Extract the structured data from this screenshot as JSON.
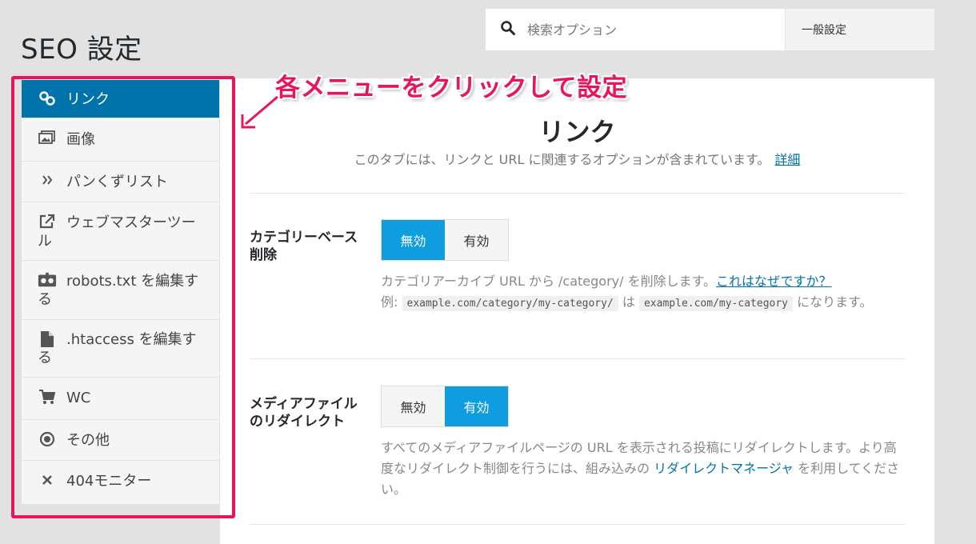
{
  "page": {
    "title": "SEO 設定"
  },
  "search": {
    "placeholder": "検索オプション",
    "scope_label": "一般設定"
  },
  "sidebar": {
    "items": [
      {
        "label": "リンク",
        "icon": "link-icon",
        "active": true
      },
      {
        "label": "画像",
        "icon": "images-icon"
      },
      {
        "label": "パンくずリスト",
        "icon": "double-chevron-icon"
      },
      {
        "label": "ウェブマスターツール",
        "icon": "external-link-icon"
      },
      {
        "label": "robots.txt を編集する",
        "icon": "robot-icon"
      },
      {
        "label": ".htaccess を編集する",
        "icon": "file-icon"
      },
      {
        "label": "WC",
        "icon": "cart-icon"
      },
      {
        "label": "その他",
        "icon": "radio-icon"
      },
      {
        "label": "404モニター",
        "icon": "close-icon"
      }
    ]
  },
  "annotation": {
    "callout_text": "各メニューをクリックして設定",
    "accent_color": "#e8155a"
  },
  "panel": {
    "title": "リンク",
    "description": "このタブには、リンクと URL に関連するオプションが含まれています。",
    "details_link": "詳細",
    "settings": [
      {
        "label": "カテゴリーベース削除",
        "options": [
          "無効",
          "有効"
        ],
        "selected": "無効",
        "desc_text": "カテゴリアーカイブ URL から /category/ を削除します。",
        "desc_link": "これはなぜですか？",
        "example_prefix": "例:",
        "example_from": "example.com/category/my-category/",
        "example_mid": "は",
        "example_to": "example.com/my-category",
        "example_suffix": "になります。"
      },
      {
        "label": "メディアファイルのリダイレクト",
        "options": [
          "無効",
          "有効"
        ],
        "selected": "有効",
        "desc_text": "すべてのメディアファイルページの URL を表示される投稿にリダイレクトします。より高度なリダイレクト制御を行うには、組み込みの",
        "desc_link": "リダイレクトマネージャ",
        "desc_suffix": "を利用してください。"
      }
    ]
  },
  "colors": {
    "primary": "#0073aa",
    "toggle_on": "#0f9de0"
  }
}
